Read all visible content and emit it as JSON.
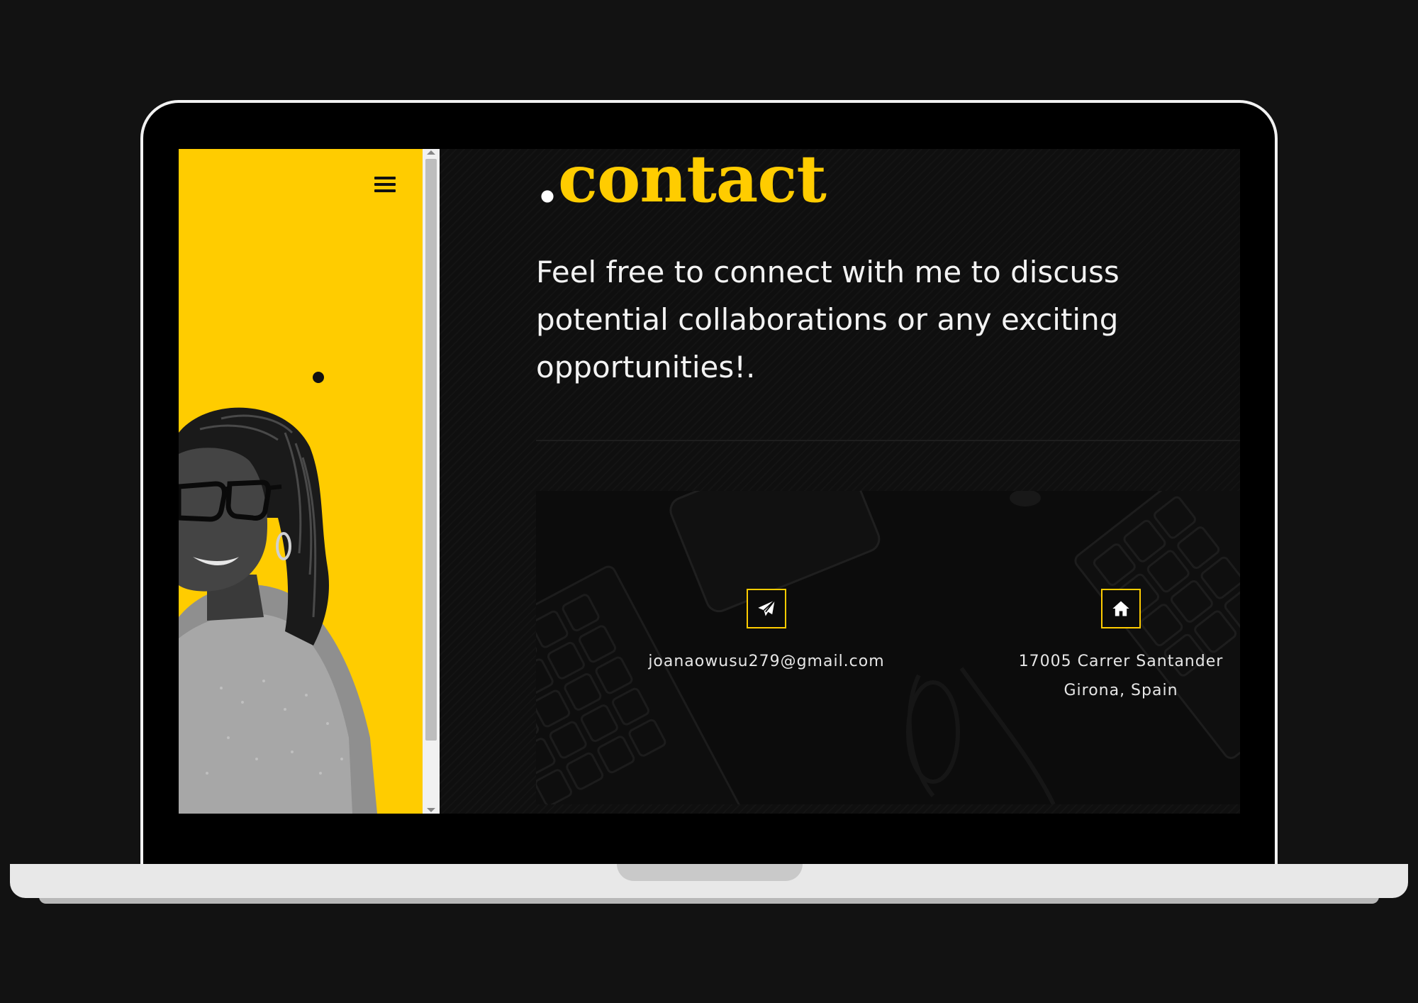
{
  "brand": {
    "accent": "#ffcc00",
    "background": "#0f0f0f",
    "text": "#f3f3f3"
  },
  "sidebar": {
    "menu_icon": "hamburger-menu-icon"
  },
  "contact": {
    "title_dot": ".",
    "title": "contact",
    "intro": "Feel free to connect with me to discuss potential collaborations or any exciting opportunities!.",
    "email": {
      "icon": "paper-plane-icon",
      "value": "joanaowusu279@gmail.com"
    },
    "address": {
      "icon": "home-icon",
      "line1": "17005 Carrer Santander",
      "line2": "Girona, Spain"
    }
  }
}
